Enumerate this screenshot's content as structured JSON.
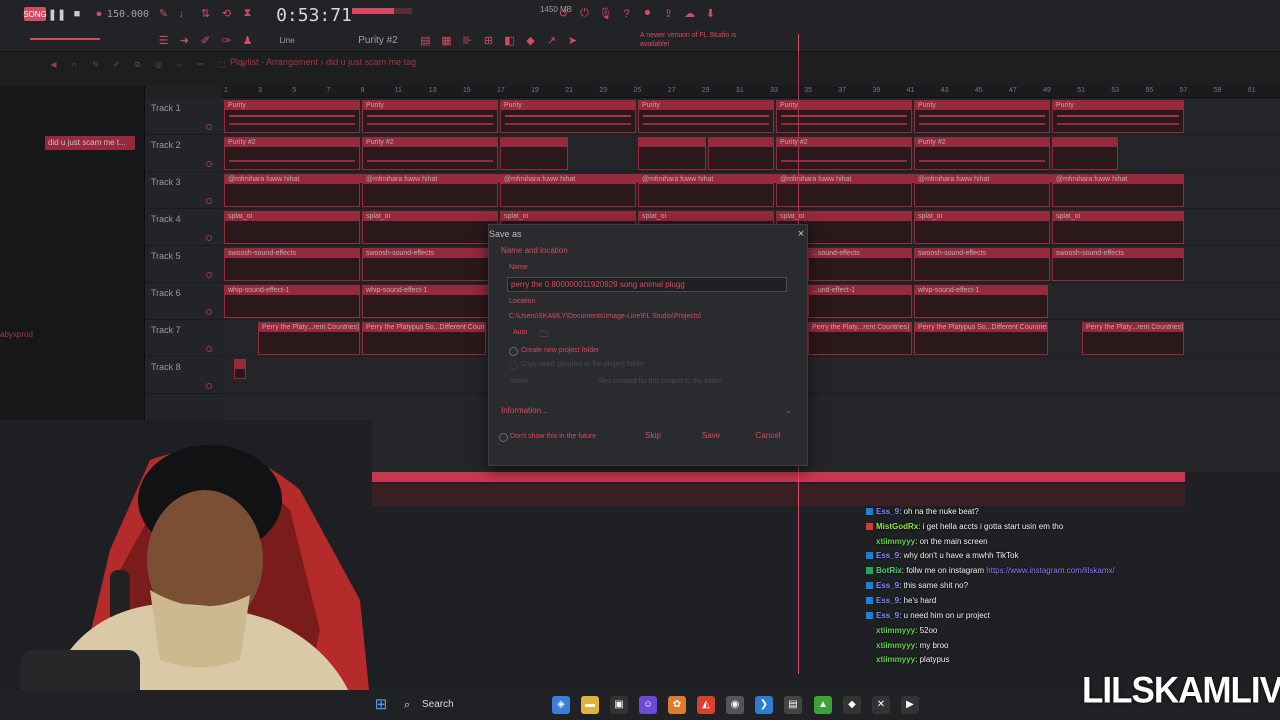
{
  "transport": {
    "song_mode": "SONG",
    "tempo": "150.000",
    "time": "0:53:71",
    "memory": "1450 MB",
    "pattern": "Purity #2",
    "snap": "Line",
    "news": "A newer version of FL Studio is available!"
  },
  "playlist": {
    "window_title": "Playlist - Arrangement",
    "separator": "›",
    "project_name": "did u just scam me tag",
    "pattern_item": "did u just scam me t...",
    "side_text": "abyxprod",
    "ruler": [
      "1",
      "3",
      "5",
      "7",
      "9",
      "11",
      "13",
      "15",
      "17",
      "19",
      "21",
      "23",
      "25",
      "27",
      "29",
      "31",
      "33",
      "35",
      "37",
      "39",
      "41",
      "43",
      "45",
      "47",
      "49",
      "51",
      "53",
      "55",
      "57",
      "59",
      "61"
    ],
    "tracks": [
      "Track 1",
      "Track 2",
      "Track 3",
      "Track 4",
      "Track 5",
      "Track 6",
      "Track 7",
      "Track 8"
    ],
    "clips": {
      "t1": "Purity",
      "t2": "Purity #2",
      "t3": "@mfmihara fuww hihat",
      "t4": "splat_oi",
      "t5": "swoosh-sound-effects",
      "t6": "whip-sound-effect-1",
      "t7a": "Perry the Platy...rent Countries)",
      "t7b": "Perry the Platypus So...Different Count",
      "t7c": "Perry the Platy...rent Countries)",
      "t7d": "Perry the Platypus So...Different Countries)",
      "t7e": "Perry the Platy...rent Countries)",
      "t5_partial": "...sound-effects",
      "t6_partial": "...und-effect-1"
    }
  },
  "dialog": {
    "title": "Save as",
    "close": "×",
    "section_name_location": "Name and location",
    "name_label": "Name",
    "name_value": "perry the 0.800000011920929 song animal plugg",
    "location_label": "Location",
    "location_path": "C:\\Users\\SKAMLY\\Documents\\Image-Line\\FL Studio\\Projects\\",
    "auto_label": "Auto",
    "create_folder": "Create new project folder",
    "copy_samples": "Copy used samples to the project folder",
    "move_label": "Move",
    "move_hint": "files created for this project to the folder",
    "information": "Information...",
    "dont_show": "Don't show this in the future",
    "skip": "Skip",
    "save": "Save",
    "cancel": "Cancel"
  },
  "chat": [
    {
      "user": "Ess_9",
      "msg": ": oh na the nuke beat?",
      "color": "#7b8cff",
      "badge": "#1d7fd6"
    },
    {
      "user": "MistGodRx",
      "msg": ": i get hella accts i gotta start usin em tho",
      "color": "#9be04c",
      "badge": "#d63b3b"
    },
    {
      "user": "xtiimmyyy",
      "msg": ": on the main screen",
      "color": "#5fd34a",
      "badge": ""
    },
    {
      "user": "Ess_9",
      "msg": ": why don't u have a mwhh TikTok",
      "color": "#7b8cff",
      "badge": "#1d7fd6"
    },
    {
      "user": "BotRix",
      "msg": ": follw me on instagram ",
      "link": "https://www.instagram.com/lilskamx/",
      "color": "#4fd17a",
      "badge": "#26a65b"
    },
    {
      "user": "Ess_9",
      "msg": ": this same shit no?",
      "color": "#7b8cff",
      "badge": "#1d7fd6"
    },
    {
      "user": "Ess_9",
      "msg": ": he's hard",
      "color": "#7b8cff",
      "badge": "#1d7fd6"
    },
    {
      "user": "Ess_9",
      "msg": ": u need him on ur project",
      "color": "#7b8cff",
      "badge": "#1d7fd6"
    },
    {
      "user": "xtiimmyyy",
      "msg": ": 52oo",
      "color": "#5fd34a",
      "badge": ""
    },
    {
      "user": "xtiimmyyy",
      "msg": ": my broo",
      "color": "#5fd34a",
      "badge": ""
    },
    {
      "user": "xtiimmyyy",
      "msg": ": platypus",
      "color": "#5fd34a",
      "badge": ""
    }
  ],
  "taskbar": {
    "search_label": "Search"
  },
  "overlay": {
    "brand": "LILSKAMLIVE"
  },
  "colors": {
    "accent": "#d84a63",
    "panel": "#2a2c2f"
  }
}
